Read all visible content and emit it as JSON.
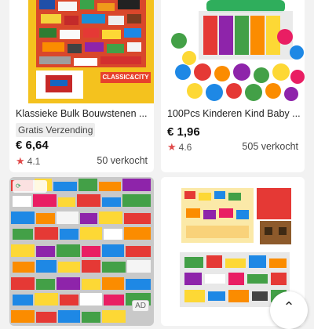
{
  "products": [
    {
      "title": "Klassieke Bulk Bouwstenen ...",
      "badge": "Gratis Verzending",
      "price": "€ 6,64",
      "rating": "4.1",
      "sold": "50 verkocht",
      "image_banner": "CLASSIC&CITY"
    },
    {
      "title": "100Pcs Kinderen Kind Baby ...",
      "price": "€ 1,96",
      "rating": "4.6",
      "sold": "505 verkocht"
    },
    {
      "ad_label": "AD"
    },
    {}
  ],
  "icons": {
    "rating": "star-icon",
    "scroll_top": "chevron-up-icon"
  },
  "colors": {
    "star": "#e04a4a",
    "background": "#f2f2f2"
  }
}
